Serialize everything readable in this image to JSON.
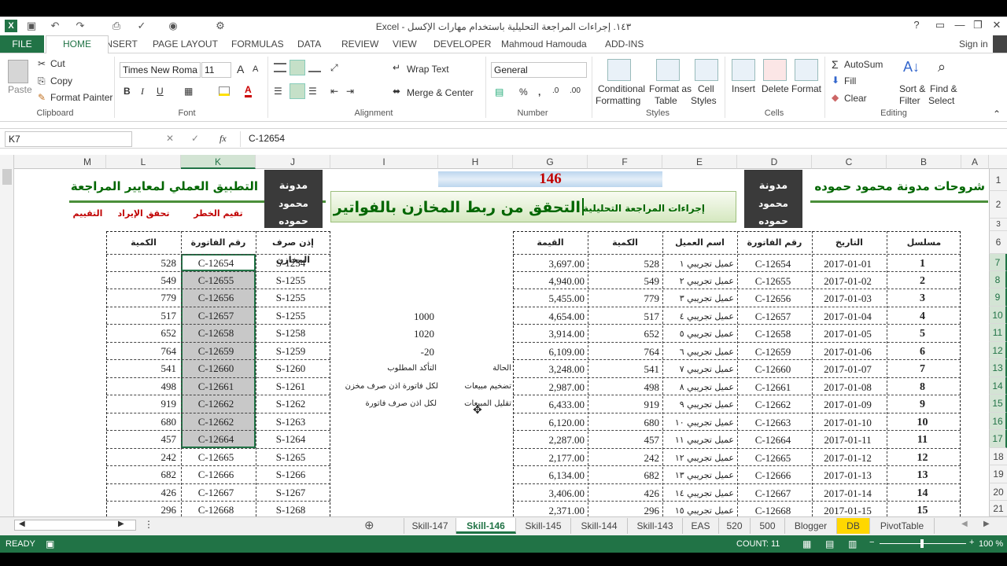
{
  "window": {
    "title": "١٤٣. إجراءات المراجعة التحليلية باستخدام مهارات الإكسل - Excel"
  },
  "ribbon_tabs": [
    "FILE",
    "HOME",
    "INSERT",
    "PAGE LAYOUT",
    "FORMULAS",
    "DATA",
    "REVIEW",
    "VIEW",
    "DEVELOPER",
    "Mahmoud Hamouda",
    "ADD-INS"
  ],
  "signin": "Sign in",
  "clipboard": {
    "paste": "Paste",
    "cut": "Cut",
    "copy": "Copy",
    "format_painter": "Format Painter",
    "label": "Clipboard"
  },
  "font": {
    "name": "Times New Roma",
    "size": "11",
    "label": "Font",
    "bold": "B",
    "italic": "I",
    "underline": "U"
  },
  "alignment": {
    "wrap": "Wrap Text",
    "merge": "Merge & Center",
    "label": "Alignment"
  },
  "number": {
    "format": "General",
    "label": "Number",
    "percent": "%"
  },
  "styles": {
    "cond": "Conditional",
    "cond2": "Formatting",
    "fat": "Format as",
    "fat2": "Table",
    "cell": "Cell",
    "cell2": "Styles",
    "label": "Styles"
  },
  "cells": {
    "insert": "Insert",
    "delete": "Delete",
    "format": "Format",
    "label": "Cells"
  },
  "editing": {
    "autosum": "AutoSum",
    "fill": "Fill",
    "clear": "Clear",
    "sort": "Sort &",
    "sort2": "Filter",
    "find": "Find &",
    "find2": "Select",
    "label": "Editing"
  },
  "formula_bar": {
    "name_box": "K7",
    "formula": "C-12654",
    "fx": "fx"
  },
  "columns": [
    "M",
    "L",
    "K",
    "J",
    "I",
    "H",
    "G",
    "F",
    "E",
    "D",
    "C",
    "B",
    "A"
  ],
  "rows": [
    "1",
    "2",
    "3",
    "6",
    "7",
    "8",
    "9",
    "10",
    "11",
    "12",
    "13",
    "14",
    "15",
    "16",
    "17",
    "18",
    "19",
    "20",
    "21"
  ],
  "sheet": {
    "g1_number": "146",
    "blog_right": "شروحات مدونة محمود حموده",
    "title_main": "التحقق من ربط المخازن بالفواتير",
    "title_sub": "إجراءات المراجعة التحليلية",
    "left_title": "التطبيق العملي لمعايير المراجعة",
    "logo1": "مدونة",
    "logo2": "محمود حموده",
    "label_eval": "التقييم",
    "label_income": "تحقق الإيراد",
    "label_risk": "تقيم الخطر",
    "right_headers": [
      "مسلسل",
      "التاريخ",
      "رقم الفاتورة",
      "اسم العميل",
      "الكمية",
      "القيمة"
    ],
    "left_headers": [
      "إذن صرف المخازن",
      "رقم الفاتورة",
      "الكمية"
    ],
    "right_rows": [
      [
        "1",
        "2017-01-01",
        "C-12654",
        "عميل تجريبي ١",
        "528",
        "3,697.00"
      ],
      [
        "2",
        "2017-01-02",
        "C-12655",
        "عميل تجريبي ٢",
        "549",
        "4,940.00"
      ],
      [
        "3",
        "2017-01-03",
        "C-12656",
        "عميل تجريبي ٣",
        "779",
        "5,455.00"
      ],
      [
        "4",
        "2017-01-04",
        "C-12657",
        "عميل تجريبي ٤",
        "517",
        "4,654.00"
      ],
      [
        "5",
        "2017-01-05",
        "C-12658",
        "عميل تجريبي ٥",
        "652",
        "3,914.00"
      ],
      [
        "6",
        "2017-01-06",
        "C-12659",
        "عميل تجريبي ٦",
        "764",
        "6,109.00"
      ],
      [
        "7",
        "2017-01-07",
        "C-12660",
        "عميل تجريبي ٧",
        "541",
        "3,248.00"
      ],
      [
        "8",
        "2017-01-08",
        "C-12661",
        "عميل تجريبي ٨",
        "498",
        "2,987.00"
      ],
      [
        "9",
        "2017-01-09",
        "C-12662",
        "عميل تجريبي ٩",
        "919",
        "6,433.00"
      ],
      [
        "10",
        "2017-01-10",
        "C-12663",
        "عميل تجريبي ١٠",
        "680",
        "6,120.00"
      ],
      [
        "11",
        "2017-01-11",
        "C-12664",
        "عميل تجريبي ١١",
        "457",
        "2,287.00"
      ],
      [
        "12",
        "2017-01-12",
        "C-12665",
        "عميل تجريبي ١٢",
        "242",
        "2,177.00"
      ],
      [
        "13",
        "2017-01-13",
        "C-12666",
        "عميل تجريبي ١٣",
        "682",
        "6,134.00"
      ],
      [
        "14",
        "2017-01-14",
        "C-12667",
        "عميل تجريبي ١٤",
        "426",
        "3,406.00"
      ],
      [
        "15",
        "2017-01-15",
        "C-12668",
        "عميل تجريبي ١٥",
        "296",
        "2,371.00"
      ]
    ],
    "left_rows": [
      [
        "S-1254",
        "C-12654",
        "528"
      ],
      [
        "S-1255",
        "C-12655",
        "549"
      ],
      [
        "S-1255",
        "C-12656",
        "779"
      ],
      [
        "S-1255",
        "C-12657",
        "517"
      ],
      [
        "S-1258",
        "C-12658",
        "652"
      ],
      [
        "S-1259",
        "C-12659",
        "764"
      ],
      [
        "S-1260",
        "C-12660",
        "541"
      ],
      [
        "S-1261",
        "C-12661",
        "498"
      ],
      [
        "S-1262",
        "C-12662",
        "919"
      ],
      [
        "S-1263",
        "C-12662",
        "680"
      ],
      [
        "S-1264",
        "C-12664",
        "457"
      ],
      [
        "S-1265",
        "C-12665",
        "242"
      ],
      [
        "S-1266",
        "C-12666",
        "682"
      ],
      [
        "S-1267",
        "C-12667",
        "426"
      ],
      [
        "S-1268",
        "C-12668",
        "296"
      ]
    ],
    "i_values": [
      "1000",
      "1020",
      "-20"
    ],
    "h_status": "الحالة",
    "i_required": "التأكد المطلوب",
    "h_r14": "تضخيم مبيعات",
    "i_r14": "لكل فاتورة اذن صرف مخزن",
    "h_r15": "تقليل المبيعات",
    "i_r15": "لكل اذن صرف فاتورة"
  },
  "sheet_tabs": [
    "Skill-147",
    "Skill-146",
    "Skill-145",
    "Skill-144",
    "Skill-143",
    "EAS",
    "520",
    "500",
    "Blogger",
    "DB",
    "PivotTable"
  ],
  "status": {
    "ready": "READY",
    "count": "COUNT: 11",
    "zoom": "100 %"
  },
  "colors": {
    "excel_green": "#217346",
    "title_green": "#006600",
    "red": "#c00000",
    "db_tab": "#ffd700"
  }
}
